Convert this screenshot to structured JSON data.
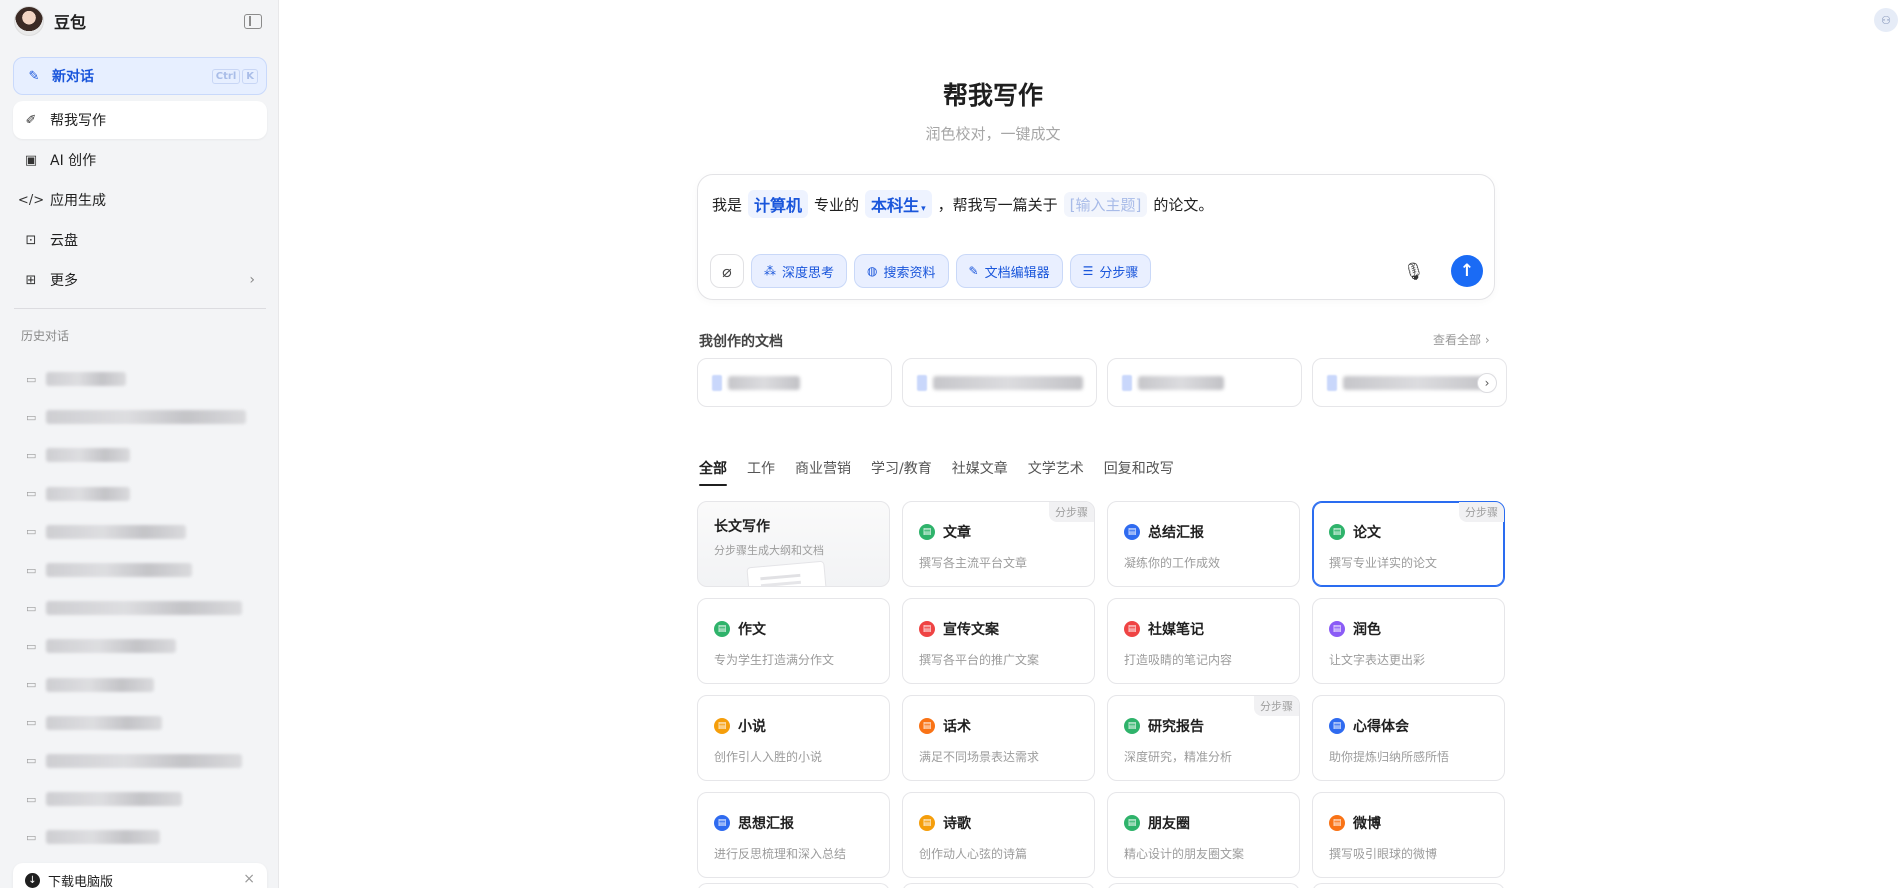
{
  "app": {
    "name": "豆包"
  },
  "sidebar": {
    "new_chat": {
      "label": "新对话",
      "shortcut": [
        "Ctrl",
        "K"
      ]
    },
    "nav": [
      {
        "label": "帮我写作",
        "icon": "pen-icon",
        "active": true
      },
      {
        "label": "AI 创作",
        "icon": "image-edit-icon"
      },
      {
        "label": "应用生成",
        "icon": "code-icon"
      },
      {
        "label": "云盘",
        "icon": "cloud-drive-icon"
      },
      {
        "label": "更多",
        "icon": "grid-icon",
        "has_chevron": true
      }
    ],
    "history_title": "历史对话",
    "history_count": 13,
    "download": {
      "label": "下载电脑版"
    }
  },
  "main": {
    "title": "帮我写作",
    "subtitle": "润色校对，一键成文",
    "prompt": {
      "p1": "我是",
      "major": "计算机",
      "p2": "专业的",
      "degree": "本科生",
      "p3": "，帮我写一篇关于",
      "topic_placeholder": "[输入主题]",
      "p4": "的论文。"
    },
    "tools": [
      {
        "label": "深度思考",
        "icon": "think-icon"
      },
      {
        "label": "搜索资料",
        "icon": "globe-icon"
      },
      {
        "label": "文档编辑器",
        "icon": "doc-edit-icon"
      },
      {
        "label": "分步骤",
        "icon": "steps-icon"
      }
    ],
    "docs": {
      "title": "我创作的文档",
      "view_all": "查看全部"
    },
    "tabs": [
      "全部",
      "工作",
      "商业营销",
      "学习/教育",
      "社媒文章",
      "文学艺术",
      "回复和改写"
    ],
    "cards": [
      {
        "title": "长文写作",
        "desc": "分步骤生成大纲和文档",
        "feature": true
      },
      {
        "title": "文章",
        "desc": "撰写各主流平台文章",
        "color": "#2fb36b",
        "tag": "分步骤"
      },
      {
        "title": "总结汇报",
        "desc": "凝练你的工作成效",
        "color": "#2f6bf0"
      },
      {
        "title": "论文",
        "desc": "撰写专业详实的论文",
        "color": "#2fb36b",
        "tag": "分步骤",
        "selected": true
      },
      {
        "title": "作文",
        "desc": "专为学生打造满分作文",
        "color": "#2fb36b"
      },
      {
        "title": "宣传文案",
        "desc": "撰写各平台的推广文案",
        "color": "#ef4444"
      },
      {
        "title": "社媒笔记",
        "desc": "打造吸睛的笔记内容",
        "color": "#ef4444"
      },
      {
        "title": "润色",
        "desc": "让文字表达更出彩",
        "color": "#8b5cf6"
      },
      {
        "title": "小说",
        "desc": "创作引人入胜的小说",
        "color": "#f59e0b"
      },
      {
        "title": "话术",
        "desc": "满足不同场景表达需求",
        "color": "#f97316"
      },
      {
        "title": "研究报告",
        "desc": "深度研究，精准分析",
        "color": "#2fb36b",
        "tag": "分步骤"
      },
      {
        "title": "心得体会",
        "desc": "助你提炼归纳所感所悟",
        "color": "#2f6bf0"
      },
      {
        "title": "思想汇报",
        "desc": "进行反思梳理和深入总结",
        "color": "#2f6bf0"
      },
      {
        "title": "诗歌",
        "desc": "创作动人心弦的诗篇",
        "color": "#f59e0b"
      },
      {
        "title": "朋友圈",
        "desc": "精心设计的朋友圈文案",
        "color": "#2fb36b"
      },
      {
        "title": "微博",
        "desc": "撰写吸引眼球的微博",
        "color": "#f97316"
      }
    ]
  }
}
